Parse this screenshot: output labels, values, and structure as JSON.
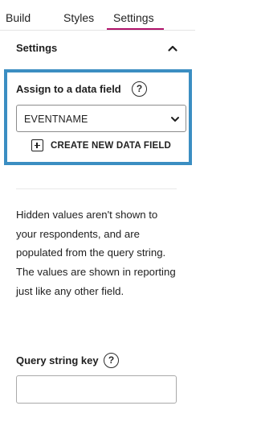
{
  "tabs": [
    {
      "label": "Build"
    },
    {
      "label": "Styles"
    },
    {
      "label": "Settings",
      "active": true
    }
  ],
  "accent_color": "#b0126a",
  "highlight_color": "#3b8ec2",
  "section": {
    "title": "Settings",
    "caret_icon": "chevron-up-icon"
  },
  "data_field": {
    "label": "Assign to a data field",
    "help_icon": "?",
    "selected_value": "EVENTNAME",
    "create_button_label": "CREATE NEW DATA FIELD"
  },
  "description": "Hidden values aren't shown to your respondents, and are populated from the query string. The values are shown in reporting just like any other field.",
  "query_string": {
    "label": "Query string key",
    "help_icon": "?",
    "value": "",
    "placeholder": ""
  }
}
